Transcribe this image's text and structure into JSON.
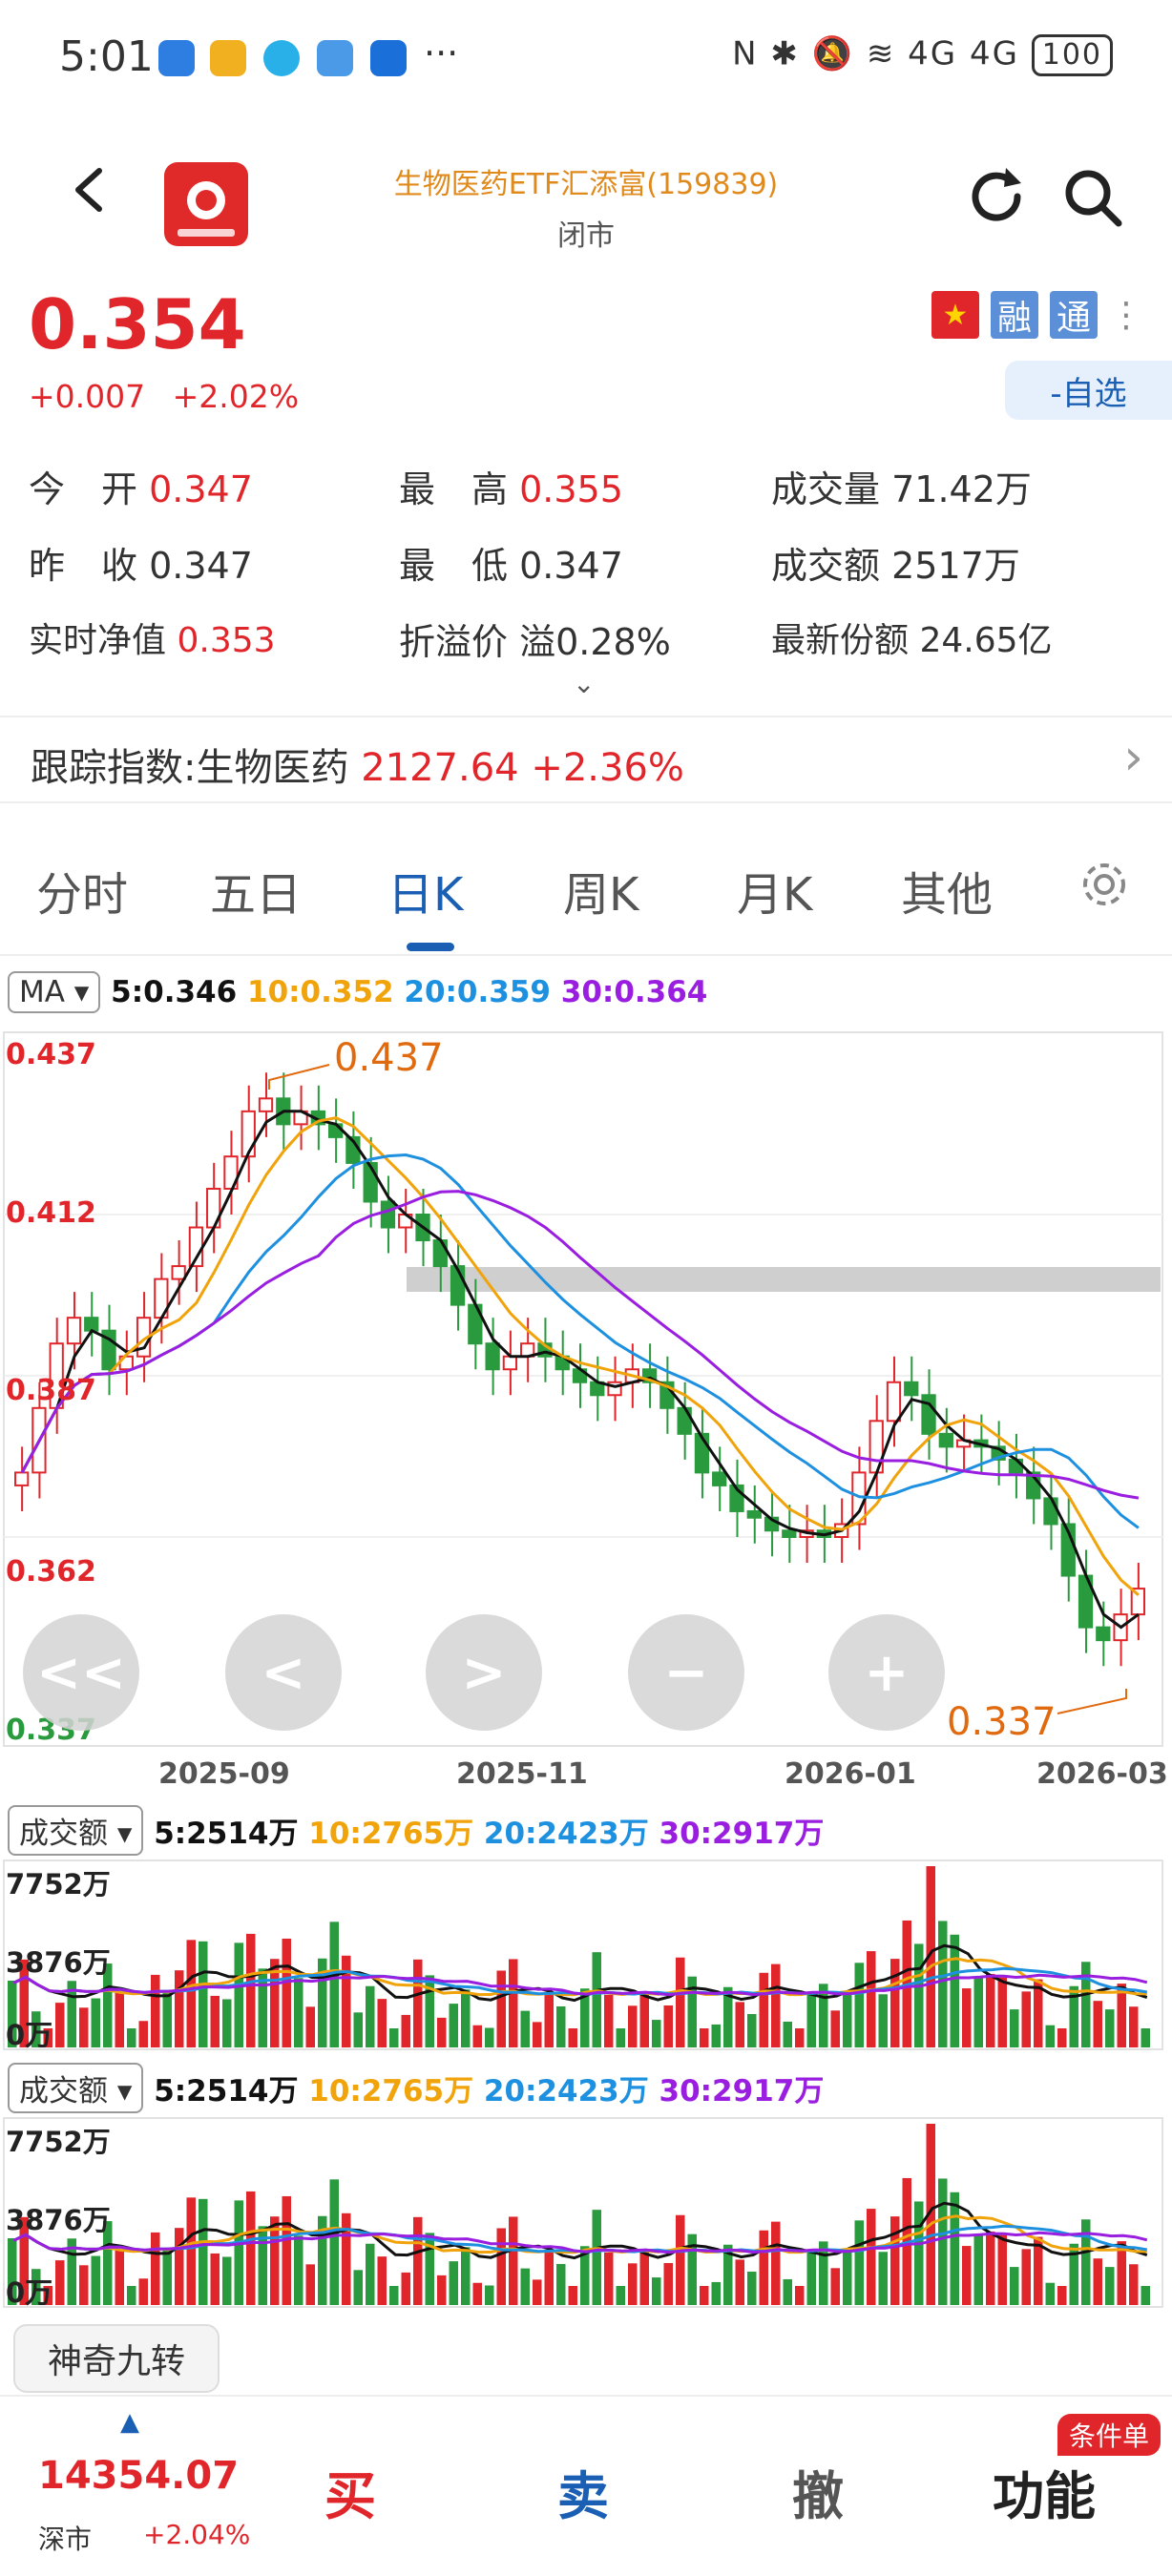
{
  "status": {
    "time": "5:01",
    "signal": "4G 4G",
    "battery": "100"
  },
  "header": {
    "title": "生物医药ETF汇添富(159839)",
    "subtitle": "闭市"
  },
  "price": {
    "last": "0.354",
    "change": "+0.007",
    "pct": "+2.02%"
  },
  "badges": {
    "rong": "融",
    "tong": "通",
    "watch": "-自选"
  },
  "quote": [
    [
      {
        "label": "今　开",
        "value": "0.347"
      },
      {
        "label": "最　高",
        "value": "0.355"
      },
      {
        "label": "成交量",
        "value": "71.42万"
      }
    ],
    [
      {
        "label": "昨　收",
        "value": "0.347"
      },
      {
        "label": "最　低",
        "value": "0.347"
      },
      {
        "label": "成交额",
        "value": "2517万"
      }
    ],
    [
      {
        "label": "实时净值",
        "value": "0.353"
      },
      {
        "label": "折溢价",
        "value": "溢0.28%"
      },
      {
        "label": "最新份额",
        "value": "24.65亿"
      }
    ]
  ],
  "tracking": {
    "label": "跟踪指数:生物医药",
    "value": "2127.64",
    "pct": "+2.36%"
  },
  "tabs": [
    "分时",
    "五日",
    "日K",
    "周K",
    "月K",
    "其他"
  ],
  "active_tab": "日K",
  "ma": {
    "selector": "MA",
    "m5": "5:0.346",
    "m10": "10:0.352",
    "m20": "20:0.359",
    "m30": "30:0.364"
  },
  "colors": {
    "up": "#e0262b",
    "down": "#2a9a3e",
    "ma5": "#111111",
    "ma10": "#f0a30a",
    "ma20": "#1e90e0",
    "ma30": "#9a1ee0",
    "accent": "#1a5fb4"
  },
  "kline_axis": {
    "y_ticks": [
      "0.437",
      "0.412",
      "0.387",
      "0.362",
      "0.337"
    ],
    "x_ticks": [
      "2025-09",
      "2025-11",
      "2026-01",
      "2026-03"
    ],
    "high_label": "0.437",
    "low_label": "0.337"
  },
  "nav_buttons": [
    "<<",
    "<",
    ">",
    "−",
    "+"
  ],
  "volume": {
    "selector": "成交额",
    "m5": "5:2514万",
    "m10": "10:2765万",
    "m20": "20:2423万",
    "m30": "30:2917万",
    "y_ticks": [
      "7752万",
      "3876万",
      "0万"
    ]
  },
  "indicator_button": "神奇九转",
  "bottom": {
    "index_value": "14354.07",
    "index_name": "深市",
    "index_pct": "+2.04%",
    "buy": "买",
    "sell": "卖",
    "cancel": "撤",
    "func": "功能",
    "cond": "条件单"
  },
  "chart_data": {
    "type": "candlestick",
    "y_range": [
      0.337,
      0.437
    ],
    "x_ticks": [
      "2025-09",
      "2025-11",
      "2026-01",
      "2026-03"
    ],
    "ma_values": {
      "ma5": 0.346,
      "ma10": 0.352,
      "ma20": 0.359,
      "ma30": 0.364
    },
    "high": 0.437,
    "low": 0.337,
    "close_series": [
      0.372,
      0.382,
      0.392,
      0.396,
      0.394,
      0.388,
      0.39,
      0.396,
      0.402,
      0.404,
      0.41,
      0.416,
      0.421,
      0.428,
      0.43,
      0.426,
      0.428,
      0.426,
      0.424,
      0.42,
      0.414,
      0.41,
      0.412,
      0.408,
      0.404,
      0.398,
      0.392,
      0.388,
      0.39,
      0.392,
      0.39,
      0.388,
      0.386,
      0.384,
      0.386,
      0.388,
      0.386,
      0.382,
      0.378,
      0.372,
      0.37,
      0.366,
      0.365,
      0.363,
      0.362,
      0.363,
      0.362,
      0.364,
      0.372,
      0.38,
      0.386,
      0.384,
      0.378,
      0.376,
      0.377,
      0.376,
      0.374,
      0.372,
      0.368,
      0.364,
      0.356,
      0.348,
      0.346,
      0.35,
      0.354
    ]
  }
}
